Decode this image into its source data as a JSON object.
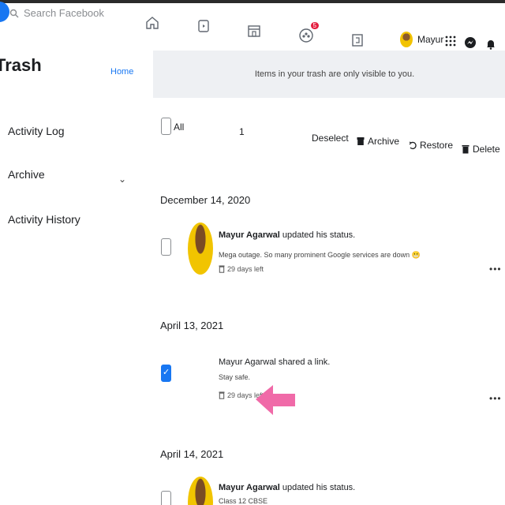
{
  "topbar": {
    "search_placeholder": "Search Facebook",
    "notifications_badge": "5",
    "profile_name": "Mayur"
  },
  "sidebar": {
    "title": "Trash",
    "home_link": "Home",
    "items": [
      {
        "label": "Activity Log"
      },
      {
        "label": "Archive"
      },
      {
        "label": "Activity History"
      }
    ]
  },
  "notice": "Items in your trash are only visible to you.",
  "toolbar": {
    "all_label": "All",
    "selected_count": "1",
    "deselect_label": "Deselect",
    "archive_label": "Archive",
    "restore_label": "Restore",
    "delete_label": "Delete"
  },
  "groups": [
    {
      "date": "December 14, 2020",
      "post": {
        "author": "Mayur Agarwal",
        "action": " updated his status.",
        "body": "Mega outage. So many prominent Google services are down 😬",
        "meta": "29 days left",
        "checked": false
      }
    },
    {
      "date": "April 13, 2021",
      "post": {
        "author": "Mayur Agarwal",
        "action": " shared a link.",
        "body": "Stay safe.",
        "meta": "29 days left",
        "checked": true
      }
    },
    {
      "date": "April 14, 2021",
      "post": {
        "author": "Mayur Agarwal",
        "action": " updated his status.",
        "body": "Class 12 CBSE",
        "meta": "",
        "checked": false
      }
    }
  ],
  "colors": {
    "accent": "#1877f2",
    "highlight_arrow": "#f06aa8",
    "notice_bg": "#eef0f3"
  }
}
